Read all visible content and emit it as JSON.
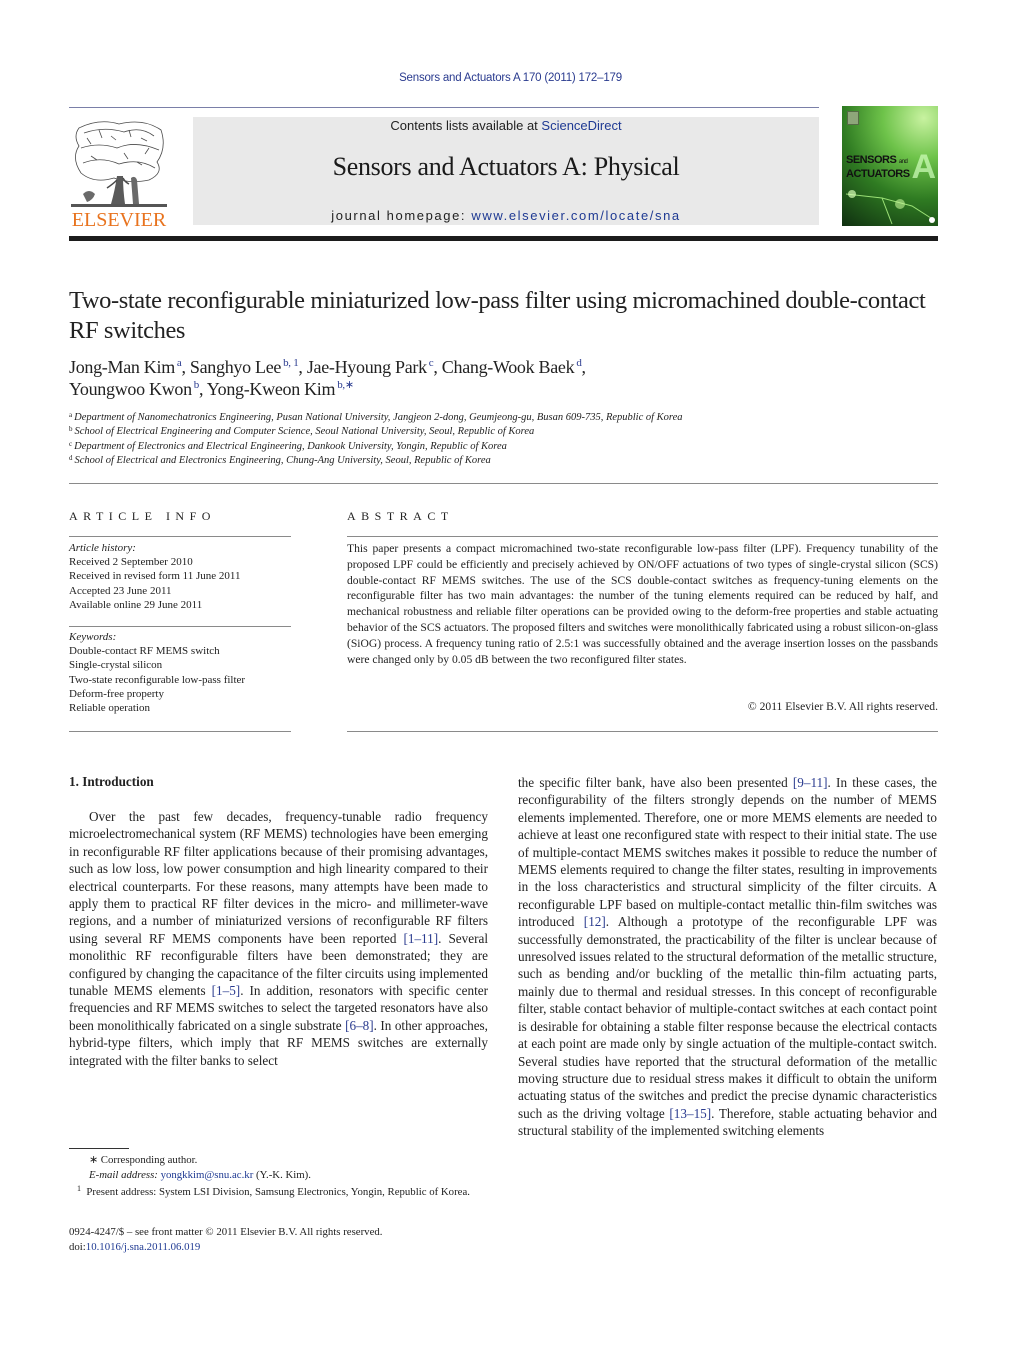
{
  "header": {
    "running_head": "Sensors and Actuators A 170 (2011) 172–179",
    "contents_prefix": "Contents lists available at ",
    "contents_link": "ScienceDirect",
    "journal_title": "Sensors and Actuators A: Physical",
    "homepage_prefix": "journal homepage: ",
    "homepage_link": "www.elsevier.com/locate/sna",
    "publisher_logo_text": "ELSEVIER",
    "cover": {
      "line1": "SENSORS",
      "line1_small": "and",
      "line2": "ACTUATORS",
      "letter": "A"
    }
  },
  "article": {
    "title": "Two-state reconfigurable miniaturized low-pass filter using micromachined double-contact RF switches",
    "authors": [
      {
        "name": "Jong-Man Kim",
        "sup": "a",
        "sep": ", "
      },
      {
        "name": "Sanghyo Lee",
        "sup": "b, 1",
        "sep": ", "
      },
      {
        "name": "Jae-Hyoung Park",
        "sup": "c",
        "sep": ", "
      },
      {
        "name": "Chang-Wook Baek",
        "sup": "d",
        "sep": ","
      },
      {
        "name": "Youngwoo Kwon",
        "sup": "b",
        "sep": ", "
      },
      {
        "name": "Yong-Kweon Kim",
        "sup": "b,∗",
        "sep": ""
      }
    ],
    "affiliations": [
      {
        "key": "a",
        "text": "Department of Nanomechatronics Engineering, Pusan National University, Jangjeon 2-dong, Geumjeong-gu, Busan 609-735, Republic of Korea"
      },
      {
        "key": "b",
        "text": "School of Electrical Engineering and Computer Science, Seoul National University, Seoul, Republic of Korea"
      },
      {
        "key": "c",
        "text": "Department of Electronics and Electrical Engineering, Dankook University, Yongin, Republic of Korea"
      },
      {
        "key": "d",
        "text": "School of Electrical and Electronics Engineering, Chung-Ang University, Seoul, Republic of Korea"
      }
    ]
  },
  "article_info": {
    "heading": "ARTICLE INFO",
    "history_label": "Article history:",
    "history": [
      "Received 2 September 2010",
      "Received in revised form 11 June 2011",
      "Accepted 23 June 2011",
      "Available online 29 June 2011"
    ],
    "keywords_label": "Keywords:",
    "keywords": [
      "Double-contact RF MEMS switch",
      "Single-crystal silicon",
      "Two-state reconfigurable low-pass filter",
      "Deform-free property",
      "Reliable operation"
    ]
  },
  "abstract": {
    "heading": "ABSTRACT",
    "text": "This paper presents a compact micromachined two-state reconfigurable low-pass filter (LPF). Frequency tunability of the proposed LPF could be efficiently and precisely achieved by ON/OFF actuations of two types of single-crystal silicon (SCS) double-contact RF MEMS switches. The use of the SCS double-contact switches as frequency-tuning elements on the reconfigurable filter has two main advantages: the number of the tuning elements required can be reduced by half, and mechanical robustness and reliable filter operations can be provided owing to the deform-free properties and stable actuating behavior of the SCS actuators. The proposed filters and switches were monolithically fabricated using a robust silicon-on-glass (SiOG) process. A frequency tuning ratio of 2.5:1 was successfully obtained and the average insertion losses on the passbands were changed only by 0.05 dB between the two reconfigured filter states.",
    "copyright": "© 2011 Elsevier B.V. All rights reserved."
  },
  "body": {
    "section_heading": "1.  Introduction",
    "left_column": [
      {
        "t": "Over the past few decades, frequency-tunable radio frequency microelectromechanical system (RF MEMS) technologies have been emerging in reconfigurable RF filter applications because of their promising advantages, such as low loss, low power consumption and high linearity compared to their electrical counterparts. For these reasons, many attempts have been made to apply them to practical RF filter devices in the micro- and millimeter-wave regions, and a number of miniaturized versions of reconfigurable RF filters using several RF MEMS components have been reported "
      },
      {
        "c": "[1–11]"
      },
      {
        "t": ". Several monolithic RF reconfigurable filters have been demonstrated; they are configured by changing the capacitance of the filter circuits using implemented tunable MEMS elements "
      },
      {
        "c": "[1–5]"
      },
      {
        "t": ". In addition, resonators with specific center frequencies and RF MEMS switches to select the targeted resonators have also been monolithically fabricated on a single substrate "
      },
      {
        "c": "[6–8]"
      },
      {
        "t": ". In other approaches, hybrid-type filters, which imply that RF MEMS switches are externally integrated with the filter banks to select"
      }
    ],
    "right_column": [
      {
        "t": "the specific filter bank, have also been presented "
      },
      {
        "c": "[9–11]"
      },
      {
        "t": ". In these cases, the reconfigurability of the filters strongly depends on the number of MEMS elements implemented. Therefore, one or more MEMS elements are needed to achieve at least one reconfigured state with respect to their initial state. The use of multiple-contact MEMS switches makes it possible to reduce the number of MEMS elements required to change the filter states, resulting in improvements in the loss characteristics and structural simplicity of the filter circuits. A reconfigurable LPF based on multiple-contact metallic thin-film switches was introduced "
      },
      {
        "c": "[12]"
      },
      {
        "t": ". Although a prototype of the reconfigurable LPF was successfully demonstrated, the practicability of the filter is unclear because of unresolved issues related to the structural deformation of the metallic structure, such as bending and/or buckling of the metallic thin-film actuating parts, mainly due to thermal and residual stresses. In this concept of reconfigurable filter, stable contact behavior of multiple-contact switches at each contact point is desirable for obtaining a stable filter response because the electrical contacts at each point are made only by single actuation of the multiple-contact switch. Several studies have reported that the structural deformation of the metallic moving structure due to residual stress makes it difficult to obtain the uniform actuating status of the switches and predict the precise dynamic characteristics such as the driving voltage "
      },
      {
        "c": "[13–15]"
      },
      {
        "t": ". Therefore, stable actuating behavior and structural stability of the implemented switching elements"
      }
    ]
  },
  "footnotes": {
    "corresponding_mark": "∗",
    "corresponding_text": "Corresponding author.",
    "email_label": "E-mail address: ",
    "email": "yongkkim@snu.ac.kr",
    "email_suffix": " (Y.-K. Kim).",
    "note1_mark": "1",
    "note1_text": "Present address: System LSI Division, Samsung Electronics, Yongin, Republic of Korea.",
    "front_matter": "0924-4247/$ – see front matter © 2011 Elsevier B.V. All rights reserved.",
    "doi_label": "doi:",
    "doi": "10.1016/j.sna.2011.06.019"
  },
  "colors": {
    "link": "#2a3b8f",
    "elsevier_orange": "#e8731e",
    "banner_gray": "#e9e9e9",
    "thick_rule": "#1c1c1c"
  }
}
